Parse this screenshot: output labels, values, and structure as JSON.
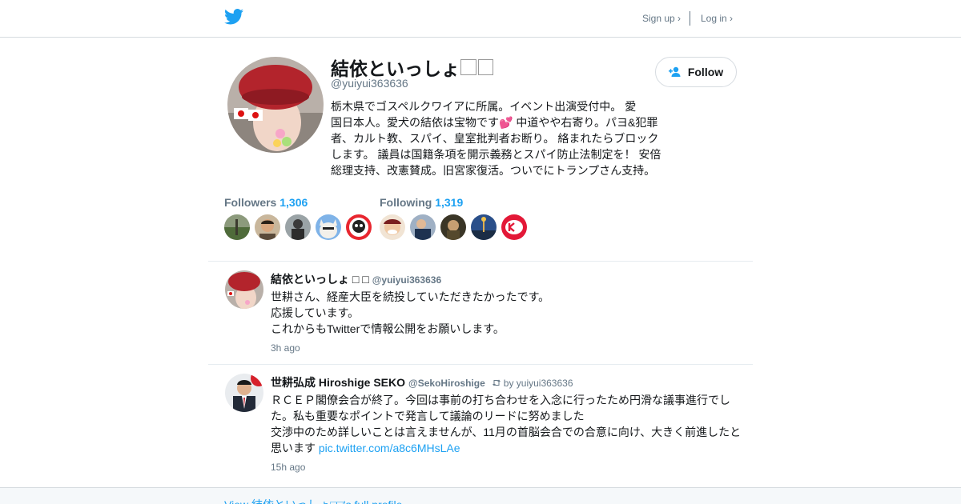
{
  "colors": {
    "accent": "#1da1f2",
    "muted": "#657786",
    "text": "#14171a",
    "border": "#e6ecf0"
  },
  "topbar": {
    "logo_icon": "twitter-bird-icon",
    "signup_label": "Sign up ›",
    "login_label": "Log in ›"
  },
  "profile": {
    "name": "結依といっしょ",
    "name_suffix": "□□",
    "handle": "@yuiyui363636",
    "bio": "栃木県でゴスペルクワイアに所属。イベント出演受付中。 愛\n国日本人。愛犬の結依は宝物です💕 中道やや右寄り。パヨ&犯罪\n者、カルト教、スパイ、皇室批判者お断り。 絡まれたらブロック\nします。 議員は国籍条項を開示義務とスパイ防止法制定を！ 安倍\n総理支持、改憲賛成。旧宮家復活。ついでにトランプさん支持。",
    "follow_label": "Follow",
    "followers_label": "Followers",
    "followers_count": "1,306",
    "following_label": "Following",
    "following_count": "1,319"
  },
  "tweets": [
    {
      "name": "結依といっしょ □ □",
      "handle": "@yuiyui363636",
      "retweet_by": "",
      "text": "世耕さん、経産大臣を続投していただきたかったです。\n応援しています。\nこれからもTwitterで情報公開をお願いします。",
      "link": "",
      "time": "3h ago"
    },
    {
      "name": "世耕弘成 Hiroshige SEKO",
      "handle": "@SekoHiroshige",
      "retweet_by": "by yuiyui363636",
      "text": "ＲＣＥＰ閣僚会合が終了。今回は事前の打ち合わせを入念に行ったため円滑な議事進行でし\nた。私も重要なポイントで発言して議論のリードに努めました\n交渉中のため詳しいことは言えませんが、11月の首脳会合での合意に向け、大きく前進したと\n思います ",
      "link": "pic.twitter.com/a8c6MHsLAe",
      "time": "15h ago"
    }
  ],
  "footer": {
    "link_label": "View 結依といっしょ□□'s full profile →"
  }
}
